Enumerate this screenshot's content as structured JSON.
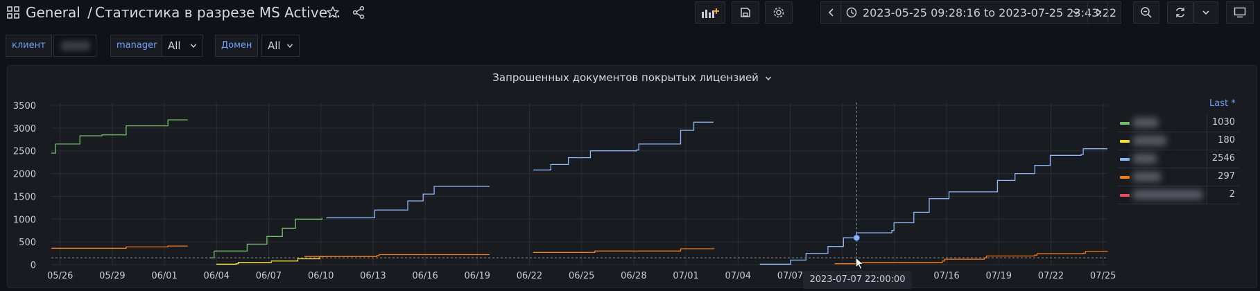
{
  "header": {
    "apps_icon": "apps-grid-icon",
    "folder": "General",
    "separator": "/",
    "title": "Статистика в разрезе MS Active...",
    "star_icon": "star-icon",
    "share_icon": "share-icon",
    "add_panel_icon": "add-panel-icon",
    "save_icon": "save-icon",
    "settings_icon": "gear-icon",
    "time_range": "2023-05-25 09:28:16 to 2023-07-25 23:43:22",
    "refresh_icon": "refresh-icon",
    "tv_icon": "tv-mode-icon"
  },
  "variables": {
    "client_label": "клиент",
    "manager_label": "manager",
    "manager_value": "All",
    "domain_label": "Домен",
    "domain_value": "All"
  },
  "panel": {
    "title": "Запрошенных документов покрытых лицензией",
    "legend_header": "Last *",
    "tooltip_time": "2023-07-07 22:00:00"
  },
  "colors": {
    "green": "#73bf69",
    "yellow": "#fade2a",
    "blue": "#8ab8ff",
    "orange": "#ff780a",
    "red": "#f2495c",
    "grid": "#2c2f36"
  },
  "chart_data": {
    "type": "line",
    "ylim": [
      0,
      3500
    ],
    "yticks": [
      0,
      500,
      1000,
      1500,
      2000,
      2500,
      3000,
      3500
    ],
    "xticks": [
      "05/26",
      "05/29",
      "06/01",
      "06/04",
      "06/07",
      "06/10",
      "06/13",
      "06/16",
      "06/19",
      "06/22",
      "06/25",
      "06/28",
      "07/01",
      "07/04",
      "07/07",
      "07/10",
      "07/13",
      "07/16",
      "07/19",
      "07/22",
      "07/25"
    ],
    "series": [
      {
        "color": "#73bf69",
        "last": "1030",
        "segments": [
          [
            [
              0,
              2450
            ],
            [
              0.2,
              2650
            ],
            [
              1.2,
              2650
            ],
            [
              1.3,
              2830
            ],
            [
              2.3,
              2850
            ],
            [
              3.3,
              2850
            ],
            [
              3.4,
              3050
            ],
            [
              5.2,
              3050
            ],
            [
              5.3,
              3180
            ],
            [
              6.2,
              3180
            ]
          ],
          [
            [
              7.2,
              150
            ],
            [
              7.4,
              300
            ],
            [
              8.8,
              300
            ],
            [
              8.9,
              450
            ],
            [
              9.7,
              450
            ],
            [
              9.8,
              620
            ],
            [
              10.4,
              620
            ],
            [
              10.5,
              800
            ],
            [
              11,
              800
            ],
            [
              11.1,
              1000
            ],
            [
              12.3,
              1030
            ]
          ]
        ]
      },
      {
        "color": "#fade2a",
        "last": "180",
        "segments": [
          [
            [
              7.5,
              10
            ],
            [
              8.4,
              20
            ],
            [
              8.5,
              50
            ],
            [
              9.9,
              50
            ],
            [
              10,
              80
            ],
            [
              11.1,
              80
            ],
            [
              11.2,
              130
            ],
            [
              12.1,
              130
            ],
            [
              12.2,
              180
            ],
            [
              12.5,
              180
            ]
          ]
        ]
      },
      {
        "color": "#8ab8ff",
        "last": "2546",
        "segments": [
          [
            [
              12.5,
              1030
            ],
            [
              14.6,
              1030
            ],
            [
              14.7,
              1200
            ],
            [
              16.1,
              1200
            ],
            [
              16.2,
              1400
            ],
            [
              16.8,
              1400
            ],
            [
              16.9,
              1550
            ],
            [
              17.3,
              1550
            ],
            [
              17.4,
              1720
            ],
            [
              19.9,
              1730
            ]
          ],
          [
            [
              21.9,
              2080
            ],
            [
              22.6,
              2080
            ],
            [
              22.7,
              2200
            ],
            [
              23.4,
              2200
            ],
            [
              23.5,
              2350
            ],
            [
              24.4,
              2350
            ],
            [
              24.5,
              2500
            ],
            [
              26.6,
              2520
            ],
            [
              26.7,
              2650
            ],
            [
              28.5,
              2650
            ],
            [
              28.6,
              2950
            ],
            [
              29.1,
              2950
            ],
            [
              29.2,
              3130
            ],
            [
              30.1,
              3130
            ]
          ],
          [
            [
              32.2,
              10
            ],
            [
              33.5,
              10
            ],
            [
              33.6,
              100
            ],
            [
              34.2,
              100
            ],
            [
              34.3,
              250
            ],
            [
              35.2,
              250
            ],
            [
              35.3,
              400
            ],
            [
              35.9,
              400
            ],
            [
              36.0,
              590
            ],
            [
              36.5,
              590
            ],
            [
              36.6,
              700
            ],
            [
              38.2,
              750
            ],
            [
              38.3,
              920
            ],
            [
              39.1,
              920
            ],
            [
              39.2,
              1150
            ],
            [
              39.8,
              1150
            ],
            [
              39.9,
              1450
            ],
            [
              40.7,
              1450
            ],
            [
              40.8,
              1600
            ],
            [
              42.9,
              1600
            ],
            [
              43.0,
              1850
            ],
            [
              43.7,
              1850
            ],
            [
              43.8,
              2000
            ],
            [
              44.6,
              2000
            ],
            [
              44.7,
              2180
            ],
            [
              45.3,
              2180
            ],
            [
              45.4,
              2400
            ],
            [
              46.8,
              2420
            ],
            [
              46.9,
              2546
            ],
            [
              48.0,
              2546
            ]
          ]
        ]
      },
      {
        "color": "#ff780a",
        "last": "297",
        "segments": [
          [
            [
              0,
              360
            ],
            [
              3.3,
              360
            ],
            [
              3.4,
              390
            ],
            [
              5.2,
              390
            ],
            [
              5.3,
              410
            ],
            [
              6.2,
              410
            ]
          ],
          [
            [
              11.5,
              180
            ],
            [
              14.8,
              200
            ],
            [
              14.9,
              220
            ],
            [
              17.6,
              220
            ],
            [
              19.9,
              230
            ]
          ],
          [
            [
              21.9,
              270
            ],
            [
              24.6,
              270
            ],
            [
              24.7,
              300
            ],
            [
              28.5,
              300
            ],
            [
              28.6,
              350
            ],
            [
              29.4,
              350
            ],
            [
              30.1,
              370
            ]
          ],
          [
            [
              35.6,
              20
            ],
            [
              36.6,
              50
            ],
            [
              40.5,
              80
            ],
            [
              40.6,
              120
            ],
            [
              42.4,
              150
            ],
            [
              42.5,
              190
            ],
            [
              44.7,
              210
            ],
            [
              44.8,
              240
            ],
            [
              46.9,
              250
            ],
            [
              47.0,
              290
            ],
            [
              48.0,
              297
            ]
          ]
        ]
      },
      {
        "color": "#f2495c",
        "last": "2",
        "segments": []
      }
    ]
  }
}
